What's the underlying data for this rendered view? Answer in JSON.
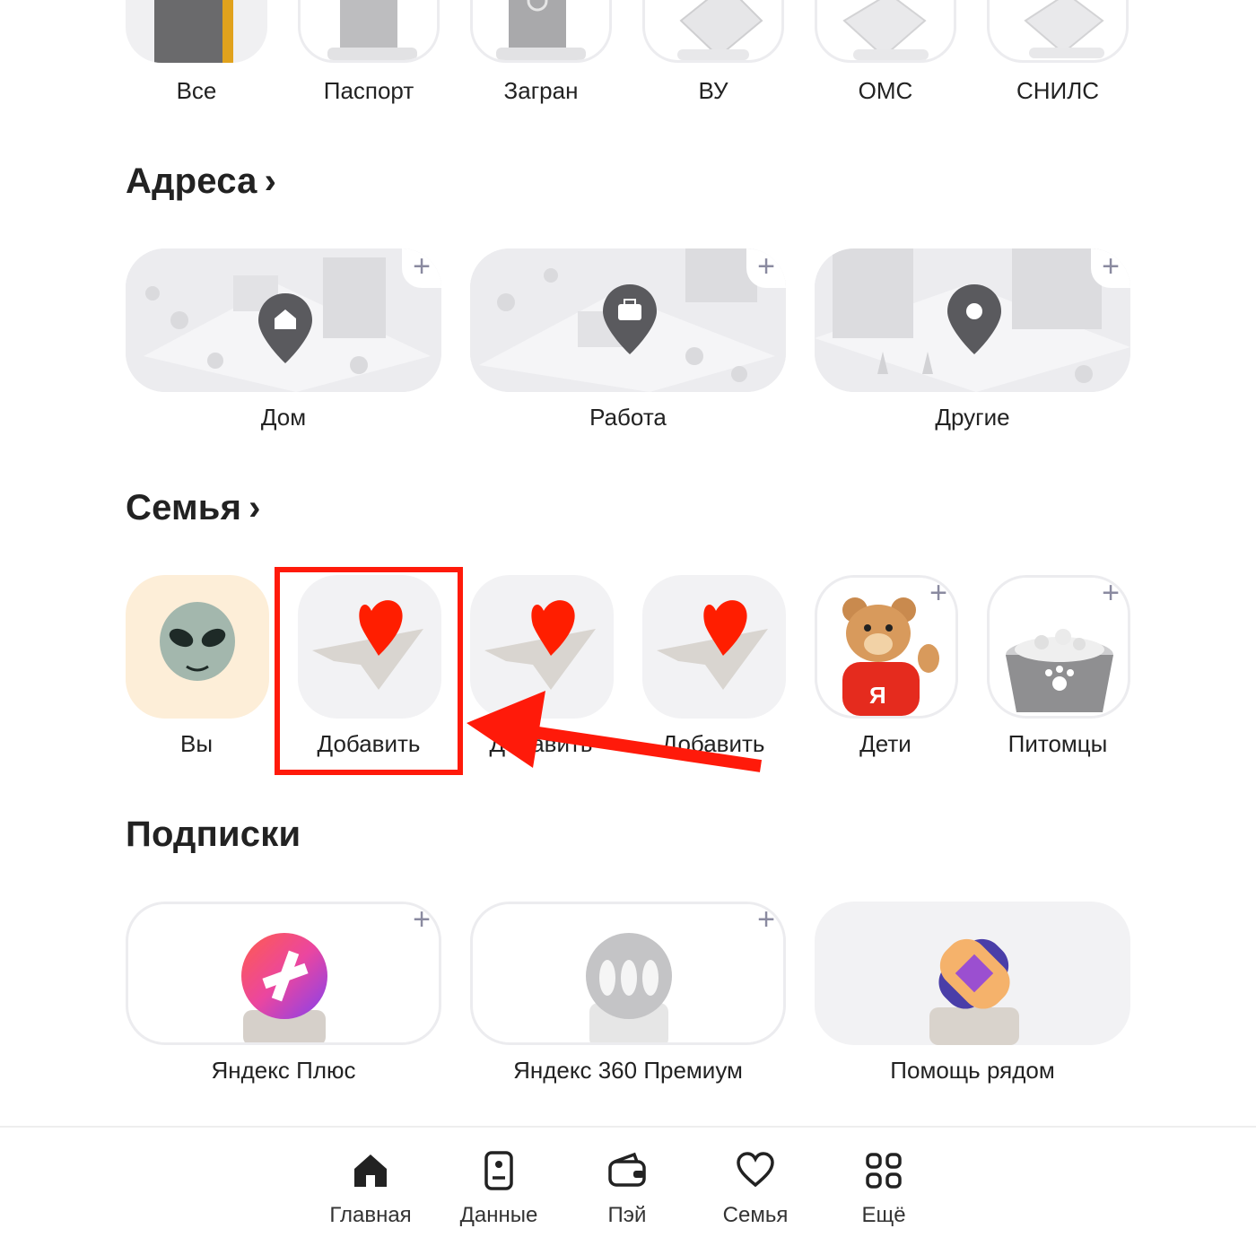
{
  "documents": {
    "items": [
      {
        "label": "Все",
        "icon": "folder-icon"
      },
      {
        "label": "Паспорт",
        "icon": "passport-icon"
      },
      {
        "label": "Загран",
        "icon": "foreign-passport-icon"
      },
      {
        "label": "ВУ",
        "icon": "driver-license-icon"
      },
      {
        "label": "ОМС",
        "icon": "medical-policy-icon"
      },
      {
        "label": "СНИЛС",
        "icon": "snils-card-icon"
      }
    ]
  },
  "addresses": {
    "title": "Адреса",
    "items": [
      {
        "label": "Дом",
        "icon": "home-pin-icon",
        "add": "+"
      },
      {
        "label": "Работа",
        "icon": "work-pin-icon",
        "add": "+"
      },
      {
        "label": "Другие",
        "icon": "location-pin-icon",
        "add": "+"
      }
    ]
  },
  "family": {
    "title": "Семья",
    "items": [
      {
        "label": "Вы",
        "icon": "alien-avatar-icon"
      },
      {
        "label": "Добавить",
        "icon": "heart-envelope-icon"
      },
      {
        "label": "Добавить",
        "icon": "heart-envelope-icon"
      },
      {
        "label": "Добавить",
        "icon": "heart-envelope-icon"
      },
      {
        "label": "Дети",
        "icon": "teddy-bear-icon",
        "add": "+"
      },
      {
        "label": "Питомцы",
        "icon": "pet-bowl-icon",
        "add": "+"
      }
    ]
  },
  "subscriptions": {
    "title": "Подписки",
    "items": [
      {
        "label": "Яндекс Плюс",
        "icon": "yandex-plus-icon",
        "add": "+"
      },
      {
        "label": "Яндекс 360 Премиум",
        "icon": "yandex-360-icon",
        "add": "+"
      },
      {
        "label": "Помощь рядом",
        "icon": "help-nearby-icon"
      }
    ]
  },
  "nav": {
    "items": [
      {
        "label": "Главная",
        "icon": "home-icon"
      },
      {
        "label": "Данные",
        "icon": "id-card-icon"
      },
      {
        "label": "Пэй",
        "icon": "wallet-icon"
      },
      {
        "label": "Семья",
        "icon": "heart-icon"
      },
      {
        "label": "Ещё",
        "icon": "more-grid-icon"
      }
    ]
  },
  "colors": {
    "annotation": "#ff1a0a",
    "heart": "#ff1e00",
    "you_tile": "#fdeed8"
  }
}
